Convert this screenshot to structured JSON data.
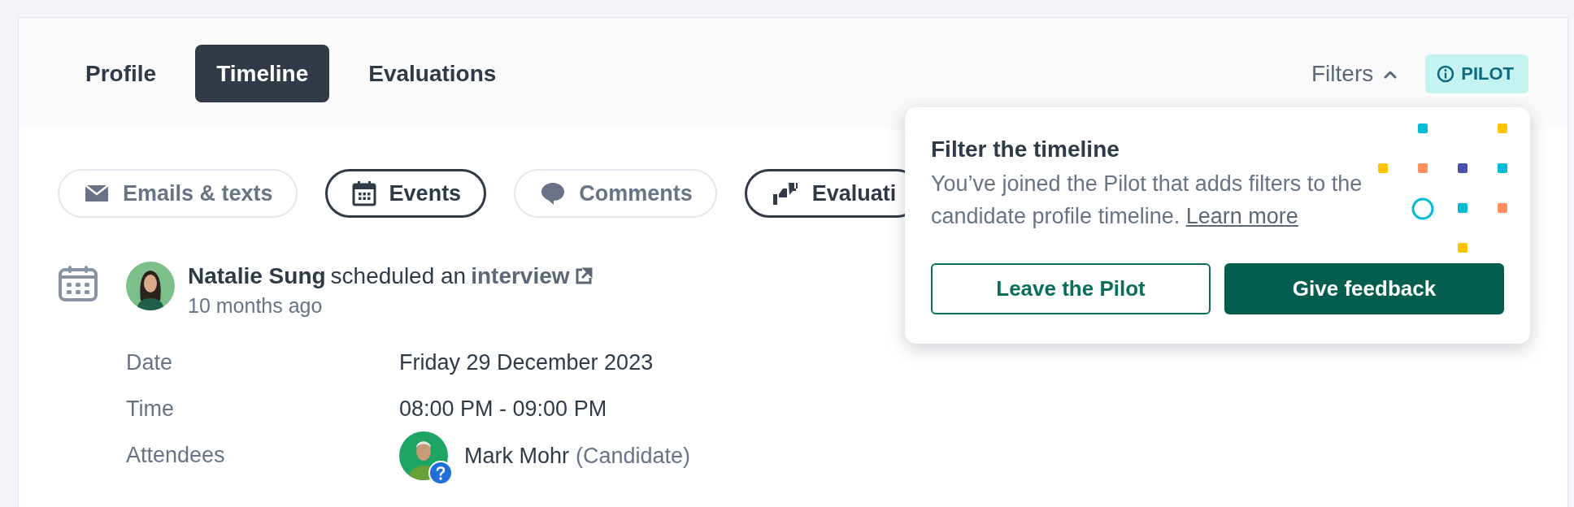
{
  "tabs": [
    {
      "label": "Profile",
      "selected": false
    },
    {
      "label": "Timeline",
      "selected": true
    },
    {
      "label": "Evaluations",
      "selected": false
    }
  ],
  "filters_toggle": {
    "label": "Filters",
    "expanded": true
  },
  "pilot_badge": {
    "label": "PILOT"
  },
  "filter_chips": [
    {
      "label": "Emails & texts",
      "kind": "mail",
      "selected": false
    },
    {
      "label": "Events",
      "kind": "calendar",
      "selected": true
    },
    {
      "label": "Comments",
      "kind": "comment",
      "selected": false
    },
    {
      "label": "Evaluati",
      "kind": "thumbs",
      "selected": true
    }
  ],
  "event": {
    "actor": "Natalie Sung",
    "action": "scheduled an",
    "link": "interview",
    "time": "10 months ago",
    "details": [
      {
        "label": "Date",
        "value": "Friday 29 December 2023"
      },
      {
        "label": "Time",
        "value": "08:00 PM - 09:00 PM"
      },
      {
        "label": "Attendees",
        "attendees": [
          {
            "name": "Mark Mohr",
            "role": "(Candidate)",
            "unconfirmed": true
          }
        ]
      }
    ]
  },
  "popup": {
    "title": "Filter the timeline",
    "body": "You’ve joined the Pilot that adds filters to the candidate profile timeline.",
    "link": "Learn more",
    "buttons": [
      {
        "label": "Leave the Pilot",
        "kind": "secondary"
      },
      {
        "label": "Give feedback",
        "kind": "primary"
      }
    ]
  }
}
